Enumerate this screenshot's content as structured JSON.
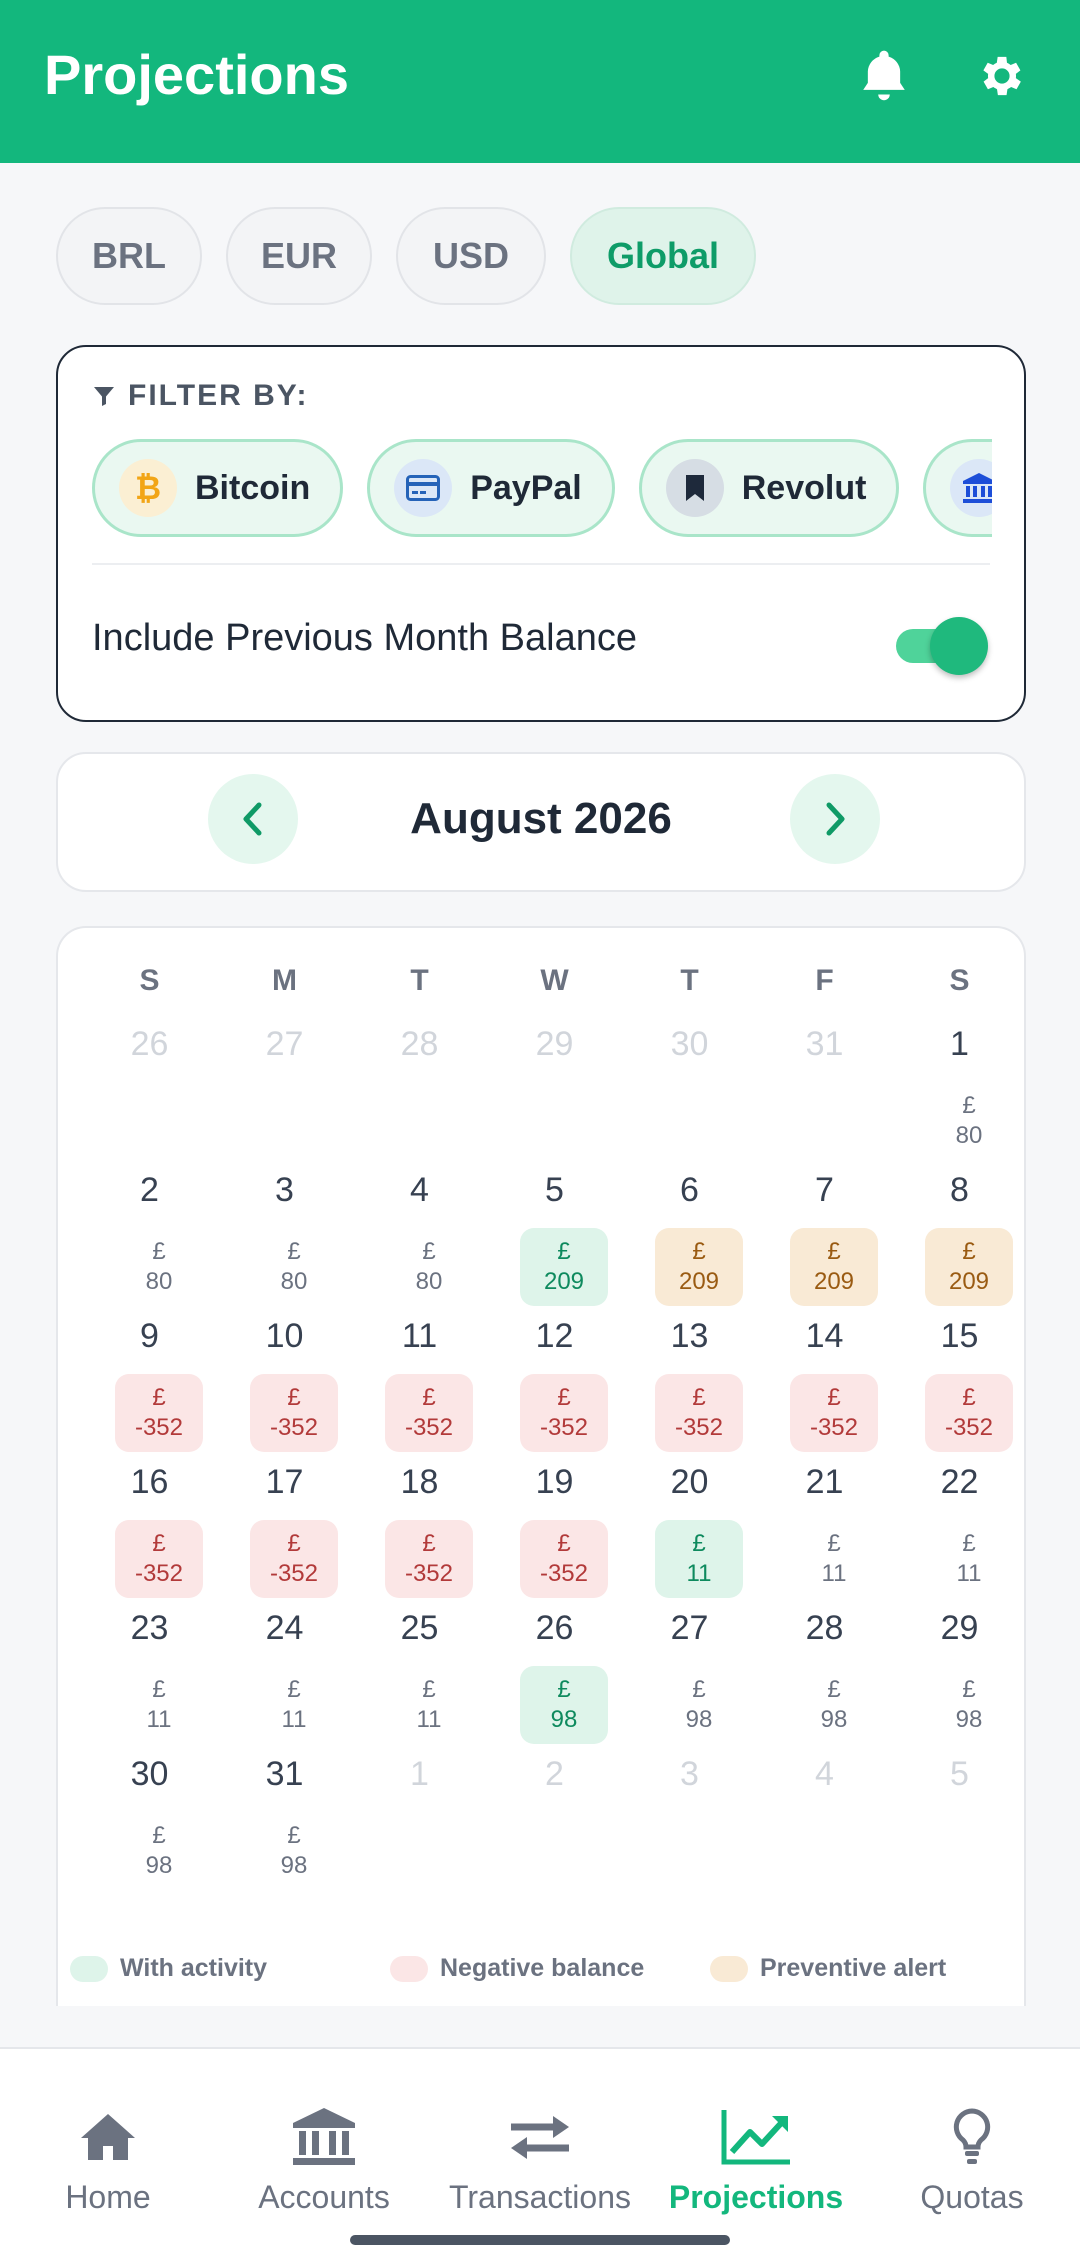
{
  "header": {
    "title": "Projections",
    "bell_icon": "bell-icon",
    "settings_icon": "gear-icon",
    "color": "#13b77d"
  },
  "currencies": [
    {
      "label": "BRL",
      "active": false
    },
    {
      "label": "EUR",
      "active": false
    },
    {
      "label": "USD",
      "active": false
    },
    {
      "label": "Global",
      "active": true
    }
  ],
  "filter": {
    "label": "FILTER BY:",
    "accounts": [
      {
        "label": "Bitcoin",
        "icon": "bitcoin-icon"
      },
      {
        "label": "PayPal",
        "icon": "credit-card-icon"
      },
      {
        "label": "Revolut",
        "icon": "bookmark-icon"
      },
      {
        "label": "",
        "icon": "bank-icon"
      }
    ],
    "toggle_label": "Include Previous Month Balance",
    "toggle_on": true
  },
  "month_nav": {
    "title": "August 2026",
    "prev_icon": "chevron-left-icon",
    "next_icon": "chevron-right-icon"
  },
  "calendar": {
    "weekdays": [
      "S",
      "M",
      "T",
      "W",
      "T",
      "F",
      "S"
    ],
    "currency_symbol": "£",
    "days": [
      {
        "d": "26",
        "out": true
      },
      {
        "d": "27",
        "out": true
      },
      {
        "d": "28",
        "out": true
      },
      {
        "d": "29",
        "out": true
      },
      {
        "d": "30",
        "out": true
      },
      {
        "d": "31",
        "out": true
      },
      {
        "d": "1",
        "amount": "80",
        "status": "none"
      },
      {
        "d": "2",
        "amount": "80",
        "status": "none"
      },
      {
        "d": "3",
        "amount": "80",
        "status": "none"
      },
      {
        "d": "4",
        "amount": "80",
        "status": "none"
      },
      {
        "d": "5",
        "amount": "209",
        "status": "activity"
      },
      {
        "d": "6",
        "amount": "209",
        "status": "alert"
      },
      {
        "d": "7",
        "amount": "209",
        "status": "alert"
      },
      {
        "d": "8",
        "amount": "209",
        "status": "alert"
      },
      {
        "d": "9",
        "amount": "-352",
        "status": "negative"
      },
      {
        "d": "10",
        "amount": "-352",
        "status": "negative"
      },
      {
        "d": "11",
        "amount": "-352",
        "status": "negative"
      },
      {
        "d": "12",
        "amount": "-352",
        "status": "negative"
      },
      {
        "d": "13",
        "amount": "-352",
        "status": "negative"
      },
      {
        "d": "14",
        "amount": "-352",
        "status": "negative"
      },
      {
        "d": "15",
        "amount": "-352",
        "status": "negative"
      },
      {
        "d": "16",
        "amount": "-352",
        "status": "negative"
      },
      {
        "d": "17",
        "amount": "-352",
        "status": "negative"
      },
      {
        "d": "18",
        "amount": "-352",
        "status": "negative"
      },
      {
        "d": "19",
        "amount": "-352",
        "status": "negative"
      },
      {
        "d": "20",
        "amount": "11",
        "status": "activity"
      },
      {
        "d": "21",
        "amount": "11",
        "status": "none"
      },
      {
        "d": "22",
        "amount": "11",
        "status": "none"
      },
      {
        "d": "23",
        "amount": "11",
        "status": "none"
      },
      {
        "d": "24",
        "amount": "11",
        "status": "none"
      },
      {
        "d": "25",
        "amount": "11",
        "status": "none"
      },
      {
        "d": "26",
        "amount": "98",
        "status": "activity"
      },
      {
        "d": "27",
        "amount": "98",
        "status": "none"
      },
      {
        "d": "28",
        "amount": "98",
        "status": "none"
      },
      {
        "d": "29",
        "amount": "98",
        "status": "none"
      },
      {
        "d": "30",
        "amount": "98",
        "status": "none"
      },
      {
        "d": "31",
        "amount": "98",
        "status": "none"
      },
      {
        "d": "1",
        "out": true
      },
      {
        "d": "2",
        "out": true
      },
      {
        "d": "3",
        "out": true
      },
      {
        "d": "4",
        "out": true
      },
      {
        "d": "5",
        "out": true
      }
    ]
  },
  "legend": [
    {
      "label": "With activity",
      "color": "#def4ea"
    },
    {
      "label": "Negative balance",
      "color": "#fbe6e6"
    },
    {
      "label": "Preventive alert",
      "color": "#f9ead5"
    }
  ],
  "bottom_nav": [
    {
      "label": "Home",
      "icon": "home-icon",
      "active": false
    },
    {
      "label": "Accounts",
      "icon": "bank-icon",
      "active": false
    },
    {
      "label": "Transactions",
      "icon": "arrows-exchange-icon",
      "active": false
    },
    {
      "label": "Projections",
      "icon": "trending-up-icon",
      "active": true
    },
    {
      "label": "Quotas",
      "icon": "lightbulb-icon",
      "active": false
    }
  ]
}
